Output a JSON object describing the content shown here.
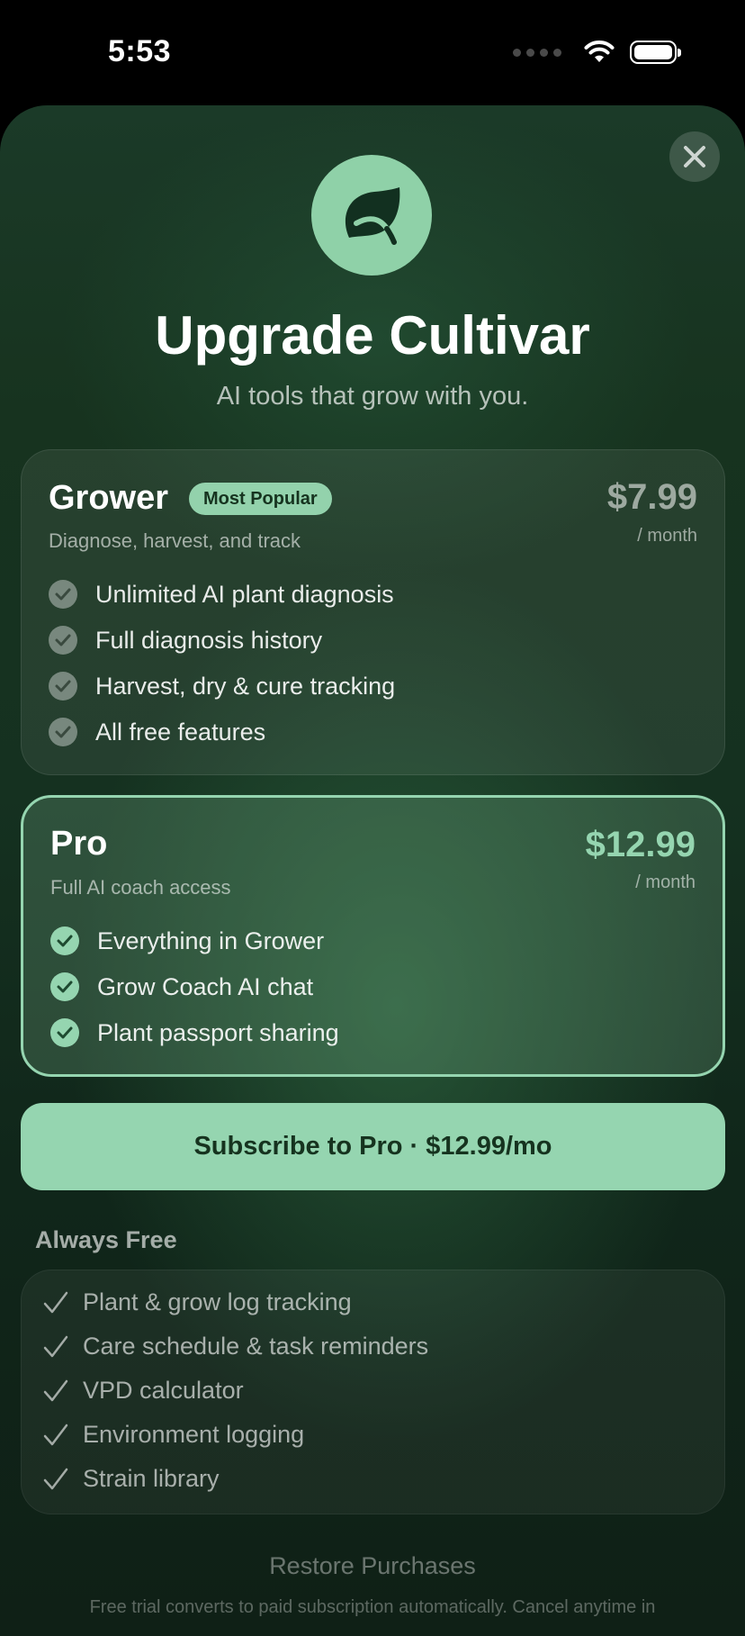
{
  "status_bar": {
    "time": "5:53"
  },
  "paywall": {
    "title": "Upgrade Cultivar",
    "subtitle": "AI tools that grow with you.",
    "plans": [
      {
        "name": "Grower",
        "badge": "Most Popular",
        "description": "Diagnose, harvest, and track",
        "price": "$7.99",
        "period": "/ month",
        "features": [
          "Unlimited AI plant diagnosis",
          "Full diagnosis history",
          "Harvest, dry & cure tracking",
          "All free features"
        ]
      },
      {
        "name": "Pro",
        "description": "Full AI coach access",
        "price": "$12.99",
        "period": "/ month",
        "features": [
          "Everything in Grower",
          "Grow Coach AI chat",
          "Plant passport sharing"
        ]
      }
    ],
    "cta_label": "Subscribe to Pro · $12.99/mo",
    "always_free": {
      "heading": "Always Free",
      "items": [
        "Plant & grow log tracking",
        "Care schedule & task reminders",
        "VPD calculator",
        "Environment logging",
        "Strain library"
      ]
    },
    "restore_label": "Restore Purchases",
    "legal_text": "Free trial converts to paid subscription automatically. Cancel anytime in"
  },
  "colors": {
    "accent": "#95d5b0",
    "accent_dark_text": "#16331f",
    "sheet_background": "#17331f"
  },
  "icons": {
    "close": "close-icon",
    "logo": "leaf-icon",
    "feature_check": "check-circle-icon",
    "free_check": "checkmark-icon"
  }
}
